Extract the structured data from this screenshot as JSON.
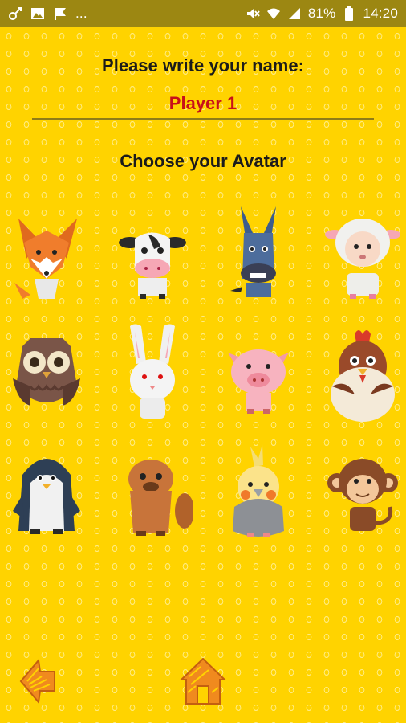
{
  "status_bar": {
    "icons_left": [
      "link-icon",
      "image-icon",
      "flag-icon"
    ],
    "overflow": "...",
    "icons_right": [
      "mute-icon",
      "wifi-icon",
      "signal-icon"
    ],
    "battery": "81%",
    "time": "14:20"
  },
  "form": {
    "prompt": "Please write your name:",
    "name_value": "Player 1",
    "avatar_heading": "Choose your Avatar"
  },
  "avatars": [
    "fox",
    "cow",
    "donkey",
    "sheep",
    "owl",
    "rabbit",
    "pig",
    "chicken",
    "penguin",
    "beaver",
    "cockatiel",
    "monkey"
  ],
  "nav": {
    "back_icon": "back-arrow-icon",
    "home_icon": "home-icon"
  },
  "colors": {
    "background": "#ffd300",
    "accent_red": "#c8101a",
    "statusbar": "#9c8712",
    "nav_orange": "#f08a1e"
  }
}
